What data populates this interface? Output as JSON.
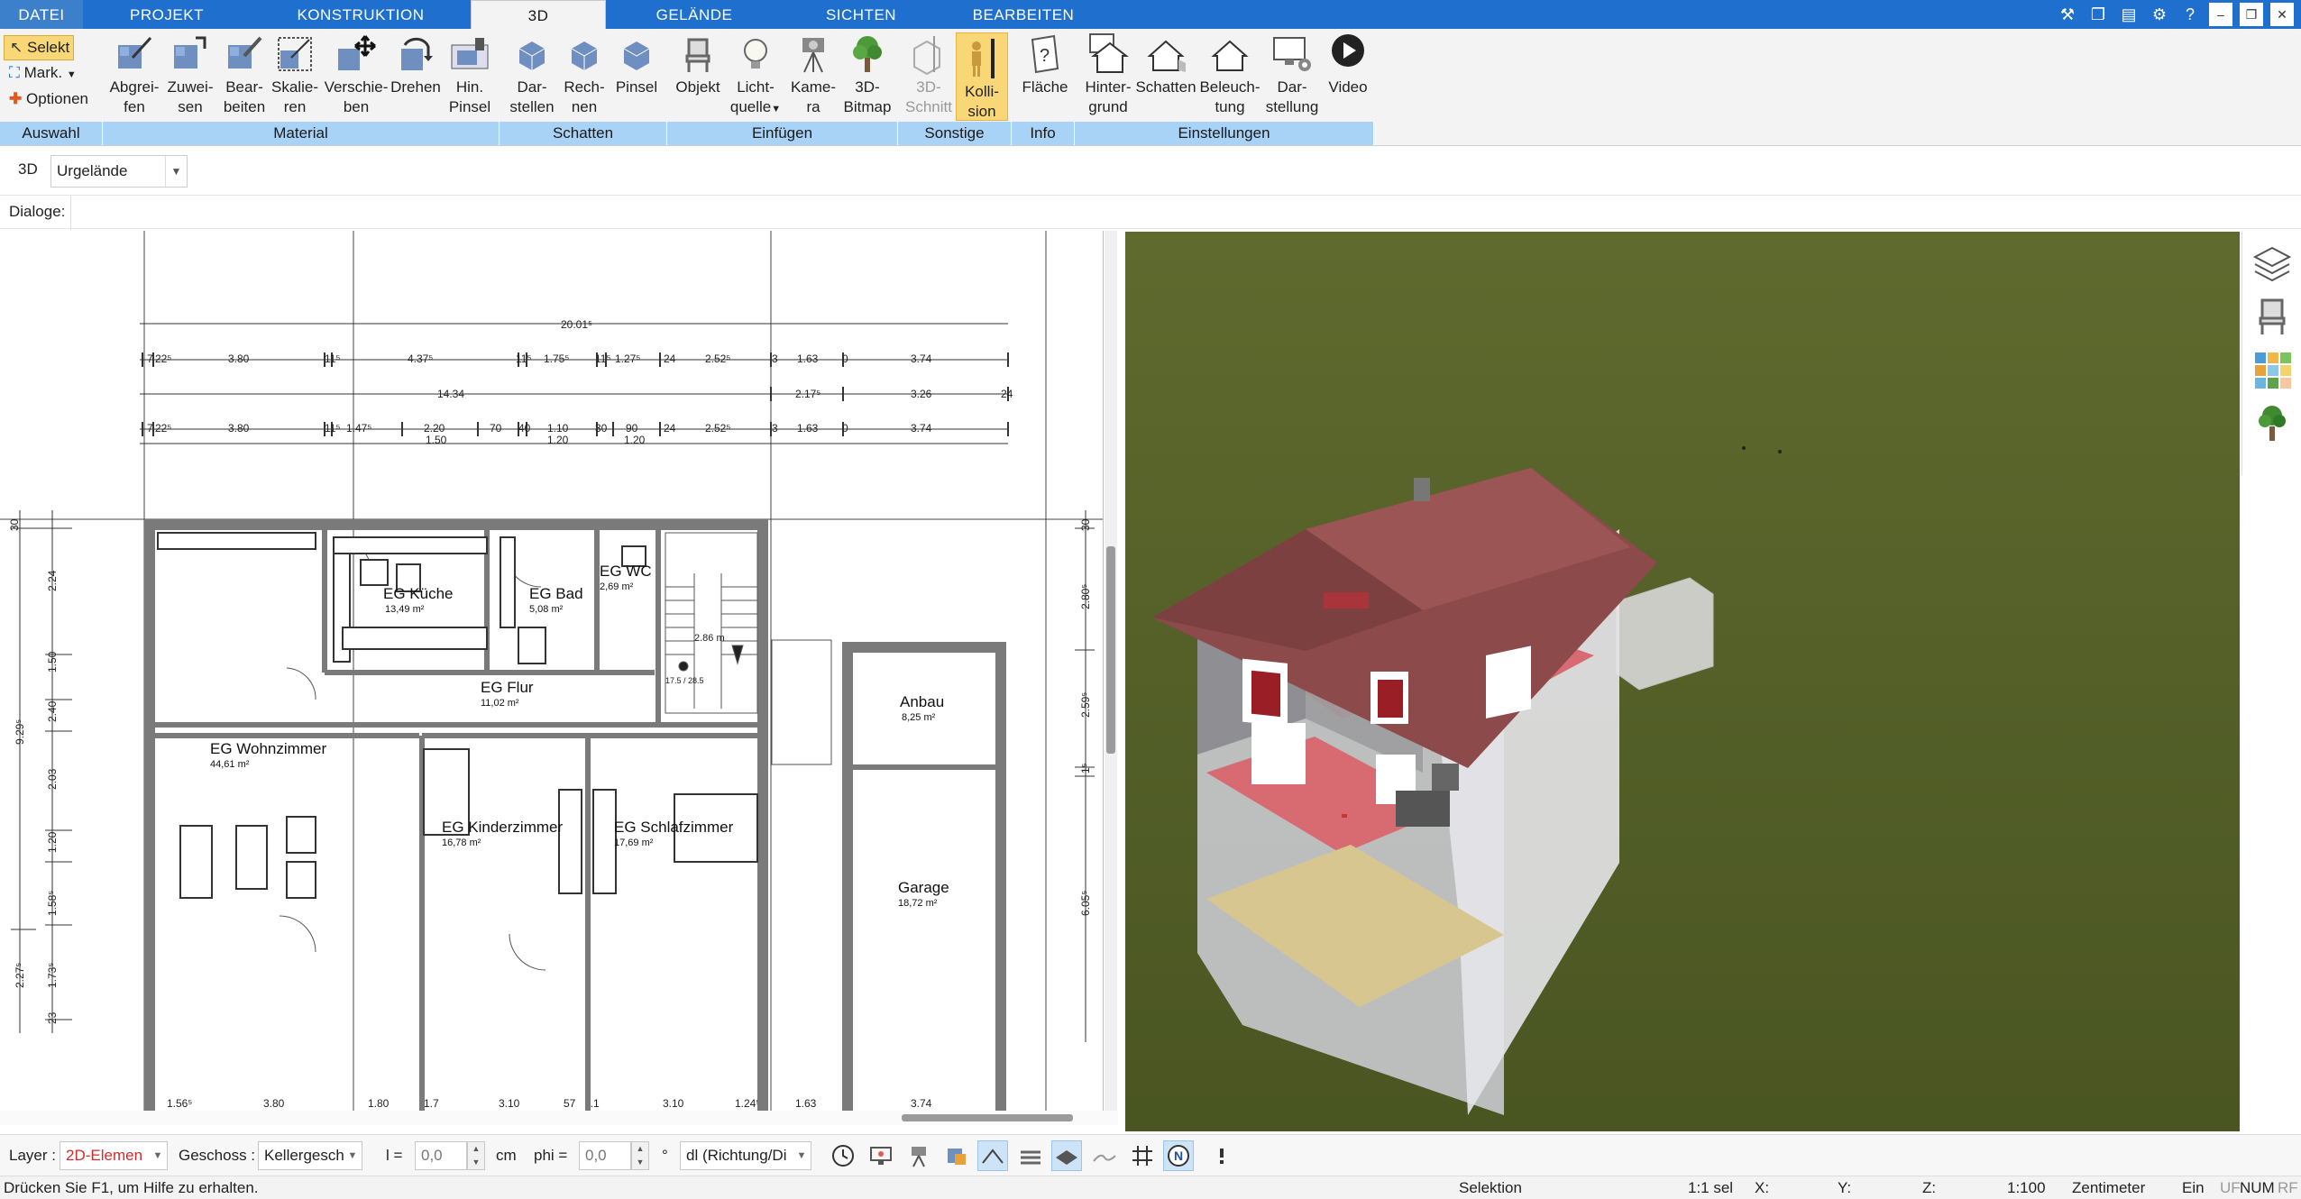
{
  "menu": {
    "file": "DATEI",
    "tabs": [
      "PROJEKT",
      "KONSTRUKTION",
      "3D",
      "GELÄNDE",
      "SICHTEN",
      "BEARBEITEN"
    ],
    "active": "3D"
  },
  "ribbon": {
    "selection": {
      "select": "Selekt",
      "mark": "Mark.",
      "options": "Optionen",
      "group": "Auswahl"
    },
    "material": {
      "group": "Material",
      "buttons": [
        {
          "l1": "Abgrei-",
          "l2": "fen"
        },
        {
          "l1": "Zuwei-",
          "l2": "sen"
        },
        {
          "l1": "Bear-",
          "l2": "beiten"
        },
        {
          "l1": "Skalie-",
          "l2": "ren"
        },
        {
          "l1": "Verschie-",
          "l2": "ben"
        },
        {
          "l1": "Drehen",
          "l2": ""
        },
        {
          "l1": "Hin.",
          "l2": "Pinsel"
        }
      ]
    },
    "schatten": {
      "group": "Schatten",
      "buttons": [
        {
          "l1": "Dar-",
          "l2": "stellen"
        },
        {
          "l1": "Rech-",
          "l2": "nen"
        },
        {
          "l1": "Pinsel",
          "l2": ""
        }
      ]
    },
    "einfuegen": {
      "group": "Einfügen",
      "buttons": [
        {
          "l1": "Objekt",
          "l2": ""
        },
        {
          "l1": "Licht-",
          "l2": "quelle"
        },
        {
          "l1": "Kame-",
          "l2": "ra"
        },
        {
          "l1": "3D-",
          "l2": "Bitmap"
        }
      ]
    },
    "sonstige": {
      "group": "Sonstige",
      "buttons": [
        {
          "l1": "3D-",
          "l2": "Schnitt"
        },
        {
          "l1": "Kolli-",
          "l2": "sion"
        }
      ]
    },
    "info": {
      "group": "Info",
      "buttons": [
        {
          "l1": "Fläche",
          "l2": ""
        }
      ]
    },
    "einstellungen": {
      "group": "Einstellungen",
      "buttons": [
        {
          "l1": "Hinter-",
          "l2": "grund"
        },
        {
          "l1": "Schatten",
          "l2": ""
        },
        {
          "l1": "Beleuch-",
          "l2": "tung"
        },
        {
          "l1": "Dar-",
          "l2": "stellung"
        },
        {
          "l1": "Video",
          "l2": ""
        }
      ]
    }
  },
  "options": {
    "view_label": "3D",
    "terrain": "Urgelände",
    "dialogs_label": "Dialoge:"
  },
  "plan": {
    "dims_top": {
      "overall": "20.01⁵",
      "row1": [
        "7",
        "22⁵",
        "3.80",
        "11⁵",
        "4.37⁵",
        "11⁵",
        "1.75⁵",
        "11⁵",
        "1.27⁵",
        "24",
        "2.52⁵",
        "3",
        "1.63",
        "0",
        "3.74"
      ],
      "row2": [
        "14.34",
        "2.17⁵",
        "3.26",
        "24"
      ],
      "row3": [
        "7",
        "22⁵",
        "3.80",
        "11⁵",
        "1.47⁵",
        "2.20",
        "1.50",
        "70",
        "40",
        "1.10",
        "1.20",
        "30",
        "90",
        "1.20",
        "24",
        "2.52⁵",
        "3",
        "1.63",
        "0",
        "3.74"
      ]
    },
    "dims_left": [
      "30",
      "2.24",
      "1.50",
      "2.40",
      "9.29⁵",
      "2.03",
      "1.20",
      "1.58⁵",
      "2.27⁵",
      "1.73⁵",
      "23"
    ],
    "dims_right": [
      "30",
      "2.80⁵",
      "2.59⁵",
      "1⁵",
      "6.05⁵"
    ],
    "dims_bottom": [
      "1.56⁵",
      "3.80",
      "1.80",
      "1.7",
      "3.10",
      "57",
      "1.1",
      "3.10",
      "1.24⁵",
      "1.63",
      "3.74"
    ],
    "rooms": [
      {
        "name": "EG Küche",
        "area": "13,49 m²"
      },
      {
        "name": "EG Bad",
        "area": "5,08 m²"
      },
      {
        "name": "EG WC",
        "area": "2,69 m²"
      },
      {
        "name": "EG Flur",
        "area": "11,02 m²"
      },
      {
        "name": "EG Wohnzimmer",
        "area": "44,61 m²"
      },
      {
        "name": "EG Kinderzimmer",
        "area": "16,78 m²"
      },
      {
        "name": "EG Schlafzimmer",
        "area": "17,69 m²"
      },
      {
        "name": "Anbau",
        "area": "8,25 m²"
      },
      {
        "name": "Garage",
        "area": "18,72 m²"
      }
    ],
    "stair": {
      "height": "2.86 m",
      "steps": "17.5 / 28.5"
    }
  },
  "bottom": {
    "layer_label": "Layer :",
    "layer_value": "2D-Elemen",
    "floor_label": "Geschoss :",
    "floor_value": "Kellergesch",
    "l_label": "l =",
    "l_value": "0,0",
    "l_unit": "cm",
    "phi_label": "phi =",
    "phi_value": "0,0",
    "phi_unit": "°",
    "mode_value": "dl (Richtung/Di",
    "north_letter": "N"
  },
  "status": {
    "help": "Drücken Sie F1, um Hilfe zu erhalten.",
    "mode": "Selektion",
    "sel": "1:1 sel",
    "x": "X:",
    "y": "Y:",
    "z": "Z:",
    "scale": "1:100",
    "unit": "Zentimeter",
    "ein": "Ein",
    "flags": [
      "UF",
      "NUM",
      "RF"
    ]
  },
  "colors": {
    "ribbon_tab": "#1e6fce",
    "group_bar": "#a9d2f7",
    "selected": "#f9d777",
    "grass": "#56612b",
    "roof": "#8c4a4a"
  }
}
